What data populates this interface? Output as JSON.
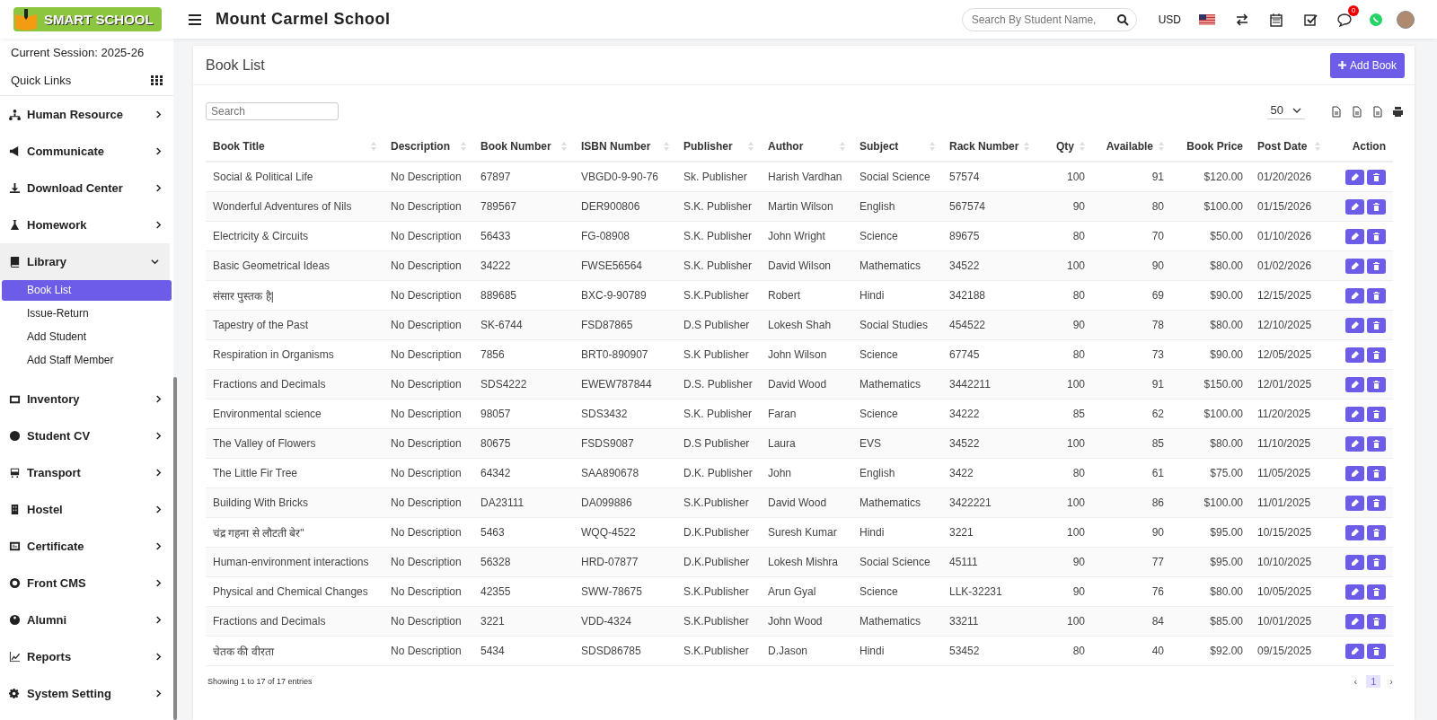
{
  "header": {
    "logo_text": "SMART SCHOOL",
    "school_name": "Mount Carmel School",
    "search": {
      "placeholder": "Search By Student Name,"
    },
    "currency": "USD",
    "chat_badge": "0"
  },
  "sidebar": {
    "session": "Current Session: 2025-26",
    "quick_links": "Quick Links",
    "items": [
      {
        "label": "Human Resource",
        "expanded": false
      },
      {
        "label": "Communicate",
        "expanded": false
      },
      {
        "label": "Download Center",
        "expanded": false
      },
      {
        "label": "Homework",
        "expanded": false
      },
      {
        "label": "Library",
        "expanded": true,
        "children": [
          {
            "label": "Book List",
            "selected": true
          },
          {
            "label": "Issue-Return",
            "selected": false
          },
          {
            "label": "Add Student",
            "selected": false
          },
          {
            "label": "Add Staff Member",
            "selected": false
          }
        ]
      },
      {
        "label": "Inventory",
        "expanded": false
      },
      {
        "label": "Student CV",
        "expanded": false
      },
      {
        "label": "Transport",
        "expanded": false
      },
      {
        "label": "Hostel",
        "expanded": false
      },
      {
        "label": "Certificate",
        "expanded": false
      },
      {
        "label": "Front CMS",
        "expanded": false
      },
      {
        "label": "Alumni",
        "expanded": false
      },
      {
        "label": "Reports",
        "expanded": false
      },
      {
        "label": "System Setting",
        "expanded": false
      }
    ]
  },
  "card": {
    "title": "Book List",
    "add_button": "Add Book",
    "search": {
      "placeholder": "Search"
    },
    "page_size": "50",
    "table": {
      "columns": [
        {
          "label": "Book Title",
          "sortable": true
        },
        {
          "label": "Description",
          "sortable": true
        },
        {
          "label": "Book Number",
          "sortable": true
        },
        {
          "label": "ISBN Number",
          "sortable": true
        },
        {
          "label": "Publisher",
          "sortable": true
        },
        {
          "label": "Author",
          "sortable": true
        },
        {
          "label": "Subject",
          "sortable": true
        },
        {
          "label": "Rack Number",
          "sortable": true
        },
        {
          "label": "Qty",
          "sortable": true
        },
        {
          "label": "Available",
          "sortable": true
        },
        {
          "label": "Book Price",
          "sortable": false
        },
        {
          "label": "Post Date",
          "sortable": true
        },
        {
          "label": "Action",
          "sortable": false
        }
      ],
      "rows": [
        [
          "Social & Political Life",
          "No Description",
          "67897",
          "VBGD0-9-90-76",
          "Sk. Publisher",
          "Harish Vardhan",
          "Social Science",
          "57574",
          "100",
          "91",
          "$120.00",
          "01/20/2026"
        ],
        [
          "Wonderful Adventures of Nils",
          "No Description",
          "789567",
          "DER900806",
          "S.K. Publisher",
          "Martin Wilson",
          "English",
          "567574",
          "90",
          "80",
          "$100.00",
          "01/15/2026"
        ],
        [
          "Electricity & Circuits",
          "No Description",
          "56433",
          "FG-08908",
          "S.K. Publisher",
          "John Wright",
          "Science",
          "89675",
          "80",
          "70",
          "$50.00",
          "01/10/2026"
        ],
        [
          "Basic Geometrical Ideas",
          "No Description",
          "34222",
          "FWSE56564",
          "S.K. Publisher",
          "David Wilson",
          "Mathematics",
          "34522",
          "100",
          "90",
          "$80.00",
          "01/02/2026"
        ],
        [
          "संसार पुस्तक है|",
          "No Description",
          "889685",
          "BXC-9-90789",
          "S.K.Publisher",
          "Robert",
          "Hindi",
          "342188",
          "80",
          "69",
          "$90.00",
          "12/15/2025"
        ],
        [
          "Tapestry of the Past",
          "No Description",
          "SK-6744",
          "FSD87865",
          "D.S Publisher",
          "Lokesh Shah",
          "Social Studies",
          "454522",
          "90",
          "78",
          "$80.00",
          "12/10/2025"
        ],
        [
          "Respiration in Organisms",
          "No Description",
          "7856",
          "BRT0-890907",
          "S.K Publisher",
          "John Wilson",
          "Science",
          "67745",
          "80",
          "73",
          "$90.00",
          "12/05/2025"
        ],
        [
          "Fractions and Decimals",
          "No Description",
          "SDS4222",
          "EWEW787844",
          "D.S. Publisher",
          "David Wood",
          "Mathematics",
          "3442211",
          "100",
          "91",
          "$150.00",
          "12/01/2025"
        ],
        [
          "Environmental science",
          "No Description",
          "98057",
          "SDS3432",
          "S.K. Publisher",
          "Faran",
          "Science",
          "34222",
          "85",
          "62",
          "$100.00",
          "11/20/2025"
        ],
        [
          "The Valley of Flowers",
          "No Description",
          "80675",
          "FSDS9087",
          "D.S Publisher",
          "Laura",
          "EVS",
          "34522",
          "100",
          "85",
          "$80.00",
          "11/10/2025"
        ],
        [
          "The Little Fir Tree",
          "No Description",
          "64342",
          "SAA890678",
          "D.K. Publisher",
          "John",
          "English",
          "3422",
          "80",
          "61",
          "$75.00",
          "11/05/2025"
        ],
        [
          "Building With Bricks",
          "No Description",
          "DA23111",
          "DA099886",
          "S.K.Publisher",
          "David Wood",
          "Mathematics",
          "3422221",
          "100",
          "86",
          "$100.00",
          "11/01/2025"
        ],
        [
          "चंद्र गहना से लौटती बेर\"",
          "No Description",
          "5463",
          "WQQ-4522",
          "D.K.Publisher",
          "Suresh Kumar",
          "Hindi",
          "3221",
          "100",
          "90",
          "$95.00",
          "10/15/2025"
        ],
        [
          "Human-environment interactions",
          "No Description",
          "56328",
          "HRD-07877",
          "D.K.Publisher",
          "Lokesh Mishra",
          "Social Science",
          "45111",
          "90",
          "77",
          "$95.00",
          "10/10/2025"
        ],
        [
          "Physical and Chemical Changes",
          "No Description",
          "42355",
          "SWW-78675",
          "S.K.Publisher",
          "Arun Gyal",
          "Science",
          "LLK-32231",
          "90",
          "76",
          "$80.00",
          "10/05/2025"
        ],
        [
          "Fractions and Decimals",
          "No Description",
          "3221",
          "VDD-4324",
          "S.K.Publisher",
          "John Wood",
          "Mathematics",
          "33211",
          "100",
          "84",
          "$85.00",
          "10/01/2025"
        ],
        [
          "चेतक की वीरता",
          "No Description",
          "5434",
          "SDSD86785",
          "S.K.Publisher",
          "D.Jason",
          "Hindi",
          "53452",
          "80",
          "40",
          "$92.00",
          "09/15/2025"
        ]
      ]
    },
    "footer": {
      "info": "Showing 1 to 17 of 17 entries",
      "prev": "‹",
      "pages": [
        {
          "label": "1",
          "selected": true
        }
      ],
      "next": "›"
    }
  }
}
